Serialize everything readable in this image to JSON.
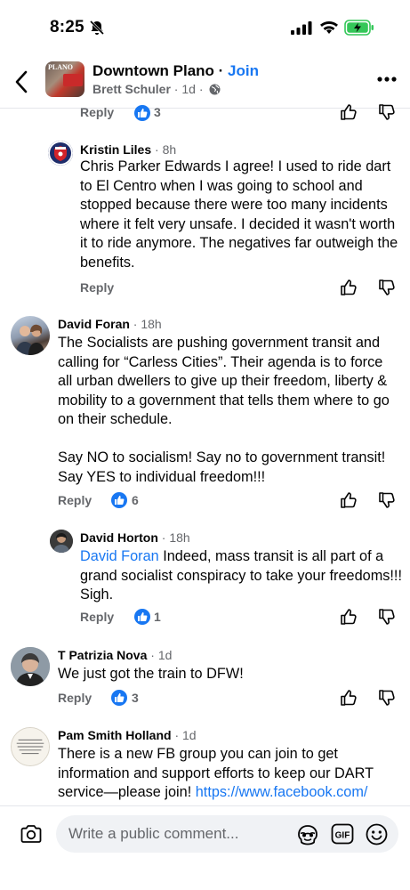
{
  "status": {
    "time": "8:25"
  },
  "header": {
    "group_name": "Downtown Plano",
    "separator": " · ",
    "join_label": "Join",
    "author": "Brett Schuler",
    "age": " · 1d ·",
    "thumb_text": "PLANO"
  },
  "top_partial": {
    "reply_label": "Reply",
    "reaction_count": "3"
  },
  "comments": [
    {
      "author": "Kristin Liles",
      "time": " · 8h",
      "text": "Chris Parker Edwards I agree! I used to ride dart to El Centro when I was going to school and stopped because there were too many incidents where it felt very unsafe. I decided it wasn't worth it to ride anymore. The negatives far outweigh the benefits.",
      "reply_label": "Reply",
      "reaction_count": ""
    },
    {
      "author": "David Foran",
      "time": " · 18h",
      "text_p1": "The Socialists are pushing government transit and calling for “Carless Cities”. Their agenda is to force all urban dwellers to give up their freedom, liberty & mobility to a government that tells them where to go on their schedule.",
      "text_p2": "Say NO to socialism! Say no to government transit! Say YES to individual freedom!!!",
      "reply_label": "Reply",
      "reaction_count": "6"
    },
    {
      "author": "David Horton",
      "time": " · 18h",
      "mention": "David Foran",
      "text": " Indeed, mass transit is all part of a grand socialist conspiracy to take your freedoms!!! Sigh.",
      "reply_label": "Reply",
      "reaction_count": "1"
    },
    {
      "author": "T Patrizia Nova",
      "time": " · 1d",
      "text": "We just got the train to DFW!",
      "reply_label": "Reply",
      "reaction_count": "3"
    },
    {
      "author": "Pam Smith Holland",
      "time": " · 1d",
      "text": "There is a new FB group you can join to get information and support efforts to keep our DART service—please join! ",
      "link": "https://www.facebook.com/"
    }
  ],
  "composer": {
    "placeholder": "Write a public comment..."
  },
  "colors": {
    "brand_blue": "#1877f2",
    "meta_gray": "#65676b",
    "text": "#050505",
    "battery_green": "#34c759"
  },
  "icons": [
    "bell-off-icon",
    "signal-icon",
    "wifi-icon",
    "battery-icon",
    "back-icon",
    "globe-icon",
    "more-icon",
    "like-icon",
    "thumbs-up-icon",
    "thumbs-down-icon",
    "camera-icon",
    "avatar-sticker-icon",
    "gif-icon",
    "emoji-icon"
  ]
}
